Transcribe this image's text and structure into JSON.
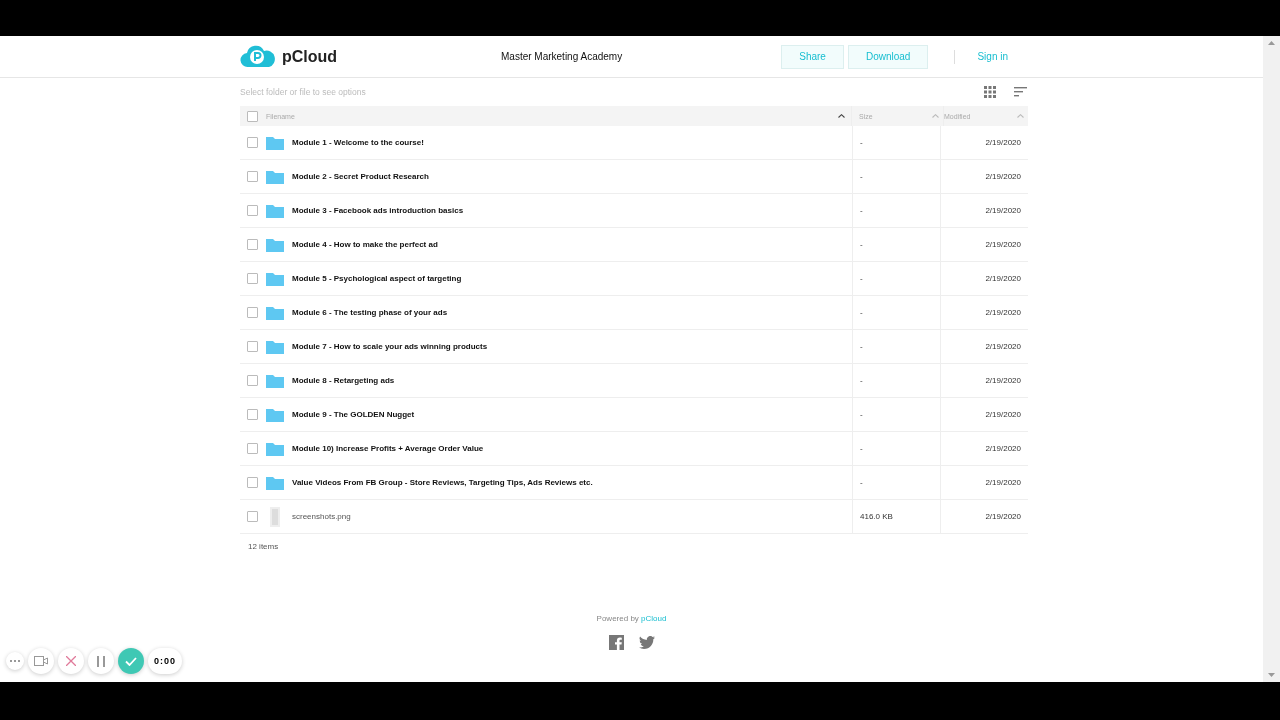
{
  "header": {
    "logo": "pCloud",
    "title": "Master Marketing Academy",
    "buttons": [
      "Share",
      "Download"
    ],
    "sign_in": "Sign in"
  },
  "toolbar": {
    "hint": "Select folder or file to see options"
  },
  "table": {
    "columns": [
      "Filename",
      "Size",
      "Modified"
    ],
    "select_all": {
      "checked": false
    },
    "rows": [
      {
        "kind": "folder",
        "name": "Module 1 - Welcome to the course!",
        "size": "-",
        "modified": "2/19/2020",
        "checked": false
      },
      {
        "kind": "folder",
        "name": "Module 2 - Secret Product Research",
        "size": "-",
        "modified": "2/19/2020",
        "checked": false
      },
      {
        "kind": "folder",
        "name": "Module 3 - Facebook ads introduction basics",
        "size": "-",
        "modified": "2/19/2020",
        "checked": false
      },
      {
        "kind": "folder",
        "name": "Module 4 - How to make the perfect ad",
        "size": "-",
        "modified": "2/19/2020",
        "checked": false
      },
      {
        "kind": "folder",
        "name": "Module 5 - Psychological aspect of targeting",
        "size": "-",
        "modified": "2/19/2020",
        "checked": false
      },
      {
        "kind": "folder",
        "name": "Module 6 - The testing phase of your ads",
        "size": "-",
        "modified": "2/19/2020",
        "checked": false
      },
      {
        "kind": "folder",
        "name": "Module 7 - How to scale your ads winning products",
        "size": "-",
        "modified": "2/19/2020",
        "checked": false
      },
      {
        "kind": "folder",
        "name": "Module 8 - Retargeting ads",
        "size": "-",
        "modified": "2/19/2020",
        "checked": false
      },
      {
        "kind": "folder",
        "name": "Module 9 - The GOLDEN Nugget",
        "size": "-",
        "modified": "2/19/2020",
        "checked": false
      },
      {
        "kind": "folder",
        "name": "Module 10) Increase Profits + Average Order Value",
        "size": "-",
        "modified": "2/19/2020",
        "checked": false
      },
      {
        "kind": "folder",
        "name": "Value Videos From FB Group - Store Reviews, Targeting Tips, Ads Reviews etc.",
        "size": "-",
        "modified": "2/19/2020",
        "checked": false
      },
      {
        "kind": "file",
        "name": "screenshots.png",
        "size": "416.0 KB",
        "modified": "2/19/2020",
        "checked": false
      }
    ],
    "count": "12 items"
  },
  "footer": {
    "powered_by": "Powered by",
    "brand_link": "pCloud"
  },
  "recorder": {
    "timer": "0:00"
  }
}
